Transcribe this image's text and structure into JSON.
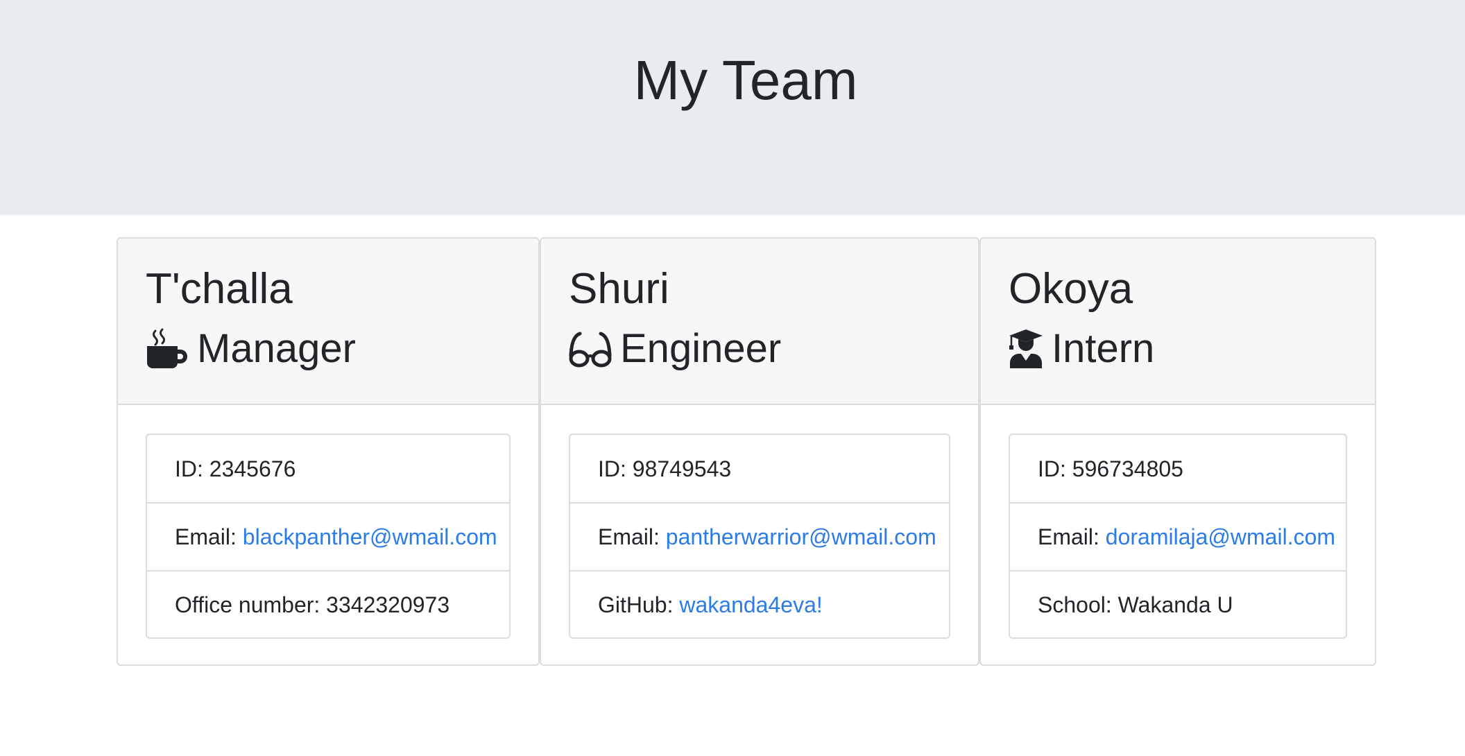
{
  "header": {
    "title": "My Team"
  },
  "team": [
    {
      "name": "T'challa",
      "role": "Manager",
      "role_icon": "mug-icon",
      "id_label": "ID: ",
      "id": "2345676",
      "email_label": "Email: ",
      "email": "blackpanther@wmail.com",
      "extra_label": "Office number: ",
      "extra_value": "3342320973"
    },
    {
      "name": "Shuri",
      "role": "Engineer",
      "role_icon": "glasses-icon",
      "id_label": "ID: ",
      "id": "98749543",
      "email_label": "Email: ",
      "email": "pantherwarrior@wmail.com",
      "extra_label": "GitHub: ",
      "extra_value": "wakanda4eva!"
    },
    {
      "name": "Okoya",
      "role": "Intern",
      "role_icon": "graduate-icon",
      "id_label": "ID: ",
      "id": "596734805",
      "email_label": "Email: ",
      "email": "doramilaja@wmail.com",
      "extra_label": "School: ",
      "extra_value": "Wakanda U"
    }
  ],
  "colors": {
    "header_bg": "#e9ecef",
    "card_header_bg": "#f7f7f7",
    "border": "#dadcdf",
    "text": "#212529",
    "link": "#2b7ce9"
  }
}
